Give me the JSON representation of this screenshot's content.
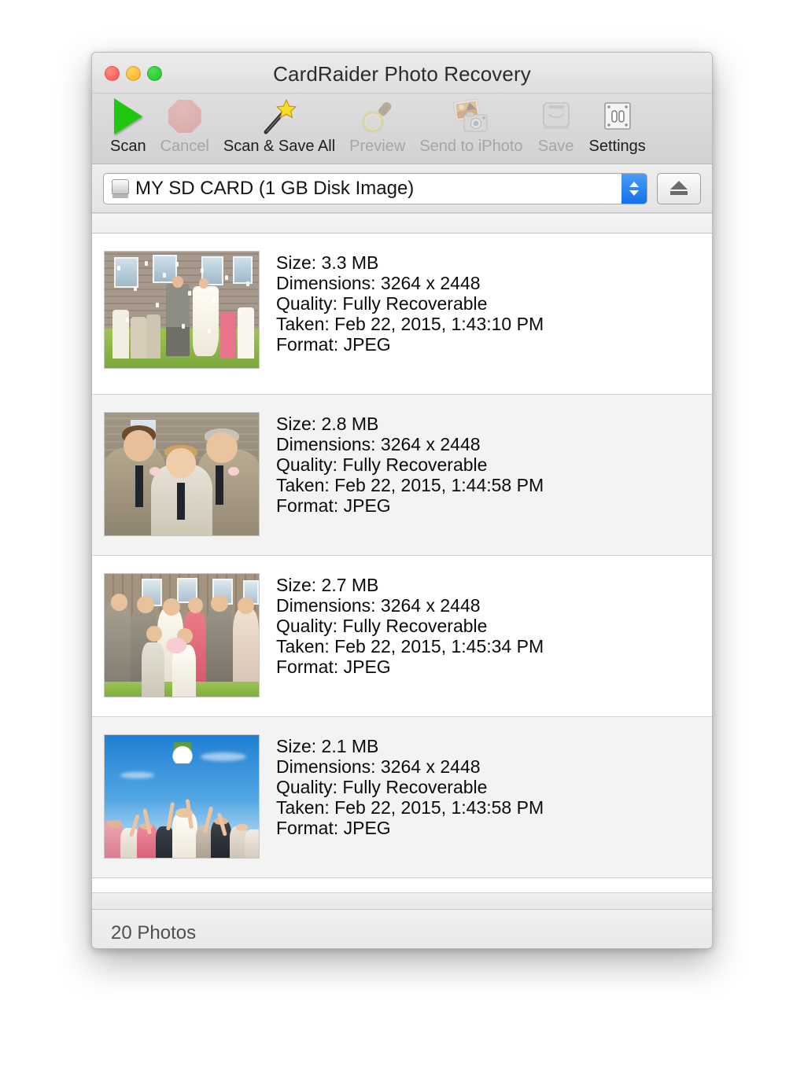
{
  "window": {
    "title": "CardRaider Photo Recovery",
    "traffic_lights": {
      "close": "close-button",
      "minimize": "minimize-button",
      "zoom": "zoom-button"
    }
  },
  "toolbar": {
    "items": [
      {
        "label": "Scan",
        "icon": "play-triangle-icon",
        "enabled": true,
        "name": "scan"
      },
      {
        "label": "Cancel",
        "icon": "stop-octagon-icon",
        "enabled": false,
        "name": "cancel"
      },
      {
        "label": "Scan & Save All",
        "icon": "magic-wand-icon",
        "enabled": true,
        "name": "scan-save-all"
      },
      {
        "label": "Preview",
        "icon": "magnifier-icon",
        "enabled": false,
        "name": "preview"
      },
      {
        "label": "Send to iPhoto",
        "icon": "photos-camera-icon",
        "enabled": false,
        "name": "send-to-iphoto"
      },
      {
        "label": "Save",
        "icon": "hard-drive-icon",
        "enabled": false,
        "name": "save"
      },
      {
        "label": "Settings",
        "icon": "switches-icon",
        "enabled": true,
        "name": "settings"
      }
    ]
  },
  "source": {
    "selected": "MY SD CARD (1 GB Disk Image)",
    "icon": "disk-icon",
    "eject_icon": "eject-icon",
    "options": [
      "MY SD CARD (1 GB Disk Image)"
    ]
  },
  "photos": [
    {
      "size": "Size: 3.3 MB",
      "dimensions": "Dimensions: 3264 x 2448",
      "quality": "Quality: Fully Recoverable",
      "taken": "Taken: Feb 22, 2015, 1:43:10 PM",
      "format": "Format: JPEG",
      "thumbnail": "wedding-confetti-run"
    },
    {
      "size": "Size: 2.8 MB",
      "dimensions": "Dimensions: 3264 x 2448",
      "quality": "Quality: Fully Recoverable",
      "taken": "Taken: Feb 22, 2015, 1:44:58 PM",
      "format": "Format: JPEG",
      "thumbnail": "groom-boy-father-portrait"
    },
    {
      "size": "Size: 2.7 MB",
      "dimensions": "Dimensions: 3264 x 2448",
      "quality": "Quality: Fully Recoverable",
      "taken": "Taken: Feb 22, 2015, 1:45:34 PM",
      "format": "Format: JPEG",
      "thumbnail": "wedding-group-portrait"
    },
    {
      "size": "Size: 2.1 MB",
      "dimensions": "Dimensions: 3264 x 2448",
      "quality": "Quality: Fully Recoverable",
      "taken": "Taken: Feb 22, 2015, 1:43:58 PM",
      "format": "Format: JPEG",
      "thumbnail": "bouquet-toss-blue-sky"
    }
  ],
  "status": {
    "count_label": "20 Photos"
  },
  "colors": {
    "accent_blue": "#1172ea",
    "close_red": "#f9524a",
    "minimize_yellow": "#f6b01c",
    "zoom_green": "#1fc423",
    "scan_green": "#1fc80f",
    "cancel_red": "#d9736d",
    "row_alt": "#f3f3f3",
    "chrome": "#ececec"
  }
}
